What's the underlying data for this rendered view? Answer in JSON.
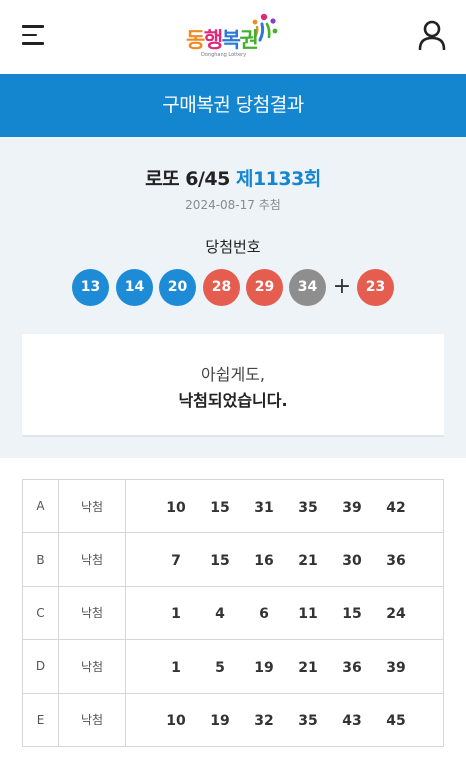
{
  "header": {
    "logo_text": "동행복권",
    "logo_sub": "Donghang Lottery",
    "logo_colors": [
      "#f08a24",
      "#e0287a",
      "#2a7ad4",
      "#43b02a",
      "#8a3fc0"
    ],
    "menu_icon": "hamburger-menu-icon",
    "user_icon": "user-icon"
  },
  "banner": {
    "title": "구매복권 당첨결과",
    "bg_color": "#1486d0"
  },
  "draw": {
    "title_prefix": "로또 6/45",
    "round": "제1133회",
    "date": "2024-08-17 추첨",
    "numbers_label": "당첨번호",
    "numbers": [
      {
        "value": "13",
        "color": "#1e8bd6"
      },
      {
        "value": "14",
        "color": "#1e8bd6"
      },
      {
        "value": "20",
        "color": "#1e8bd6"
      },
      {
        "value": "28",
        "color": "#e45d4f"
      },
      {
        "value": "29",
        "color": "#e45d4f"
      },
      {
        "value": "34",
        "color": "#8e8e8e"
      }
    ],
    "plus": "+",
    "bonus": {
      "value": "23",
      "color": "#e45d4f"
    }
  },
  "message": {
    "line1": "아쉽게도,",
    "line2": "낙첨되었습니다."
  },
  "games": [
    {
      "game": "A",
      "result": "낙첨",
      "numbers": [
        "10",
        "15",
        "31",
        "35",
        "39",
        "42"
      ]
    },
    {
      "game": "B",
      "result": "낙첨",
      "numbers": [
        "7",
        "15",
        "16",
        "21",
        "30",
        "36"
      ]
    },
    {
      "game": "C",
      "result": "낙첨",
      "numbers": [
        "1",
        "4",
        "6",
        "11",
        "15",
        "24"
      ]
    },
    {
      "game": "D",
      "result": "낙첨",
      "numbers": [
        "1",
        "5",
        "19",
        "21",
        "36",
        "39"
      ]
    },
    {
      "game": "E",
      "result": "낙첨",
      "numbers": [
        "10",
        "19",
        "32",
        "35",
        "43",
        "45"
      ]
    }
  ]
}
